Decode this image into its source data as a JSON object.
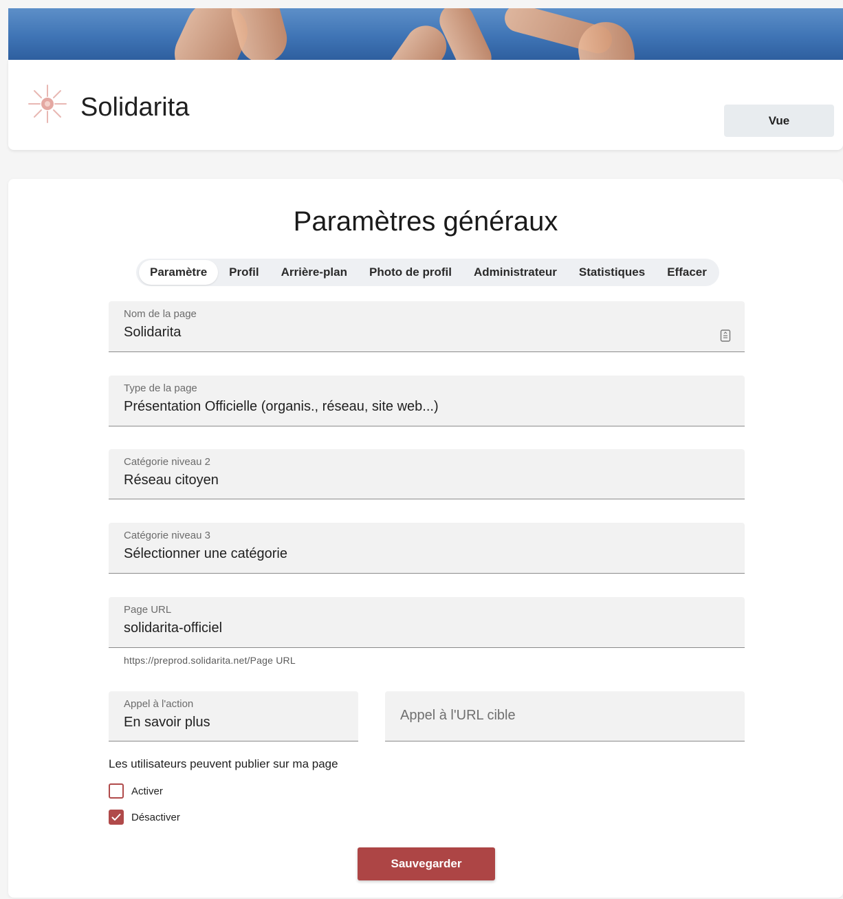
{
  "header": {
    "page_name": "Solidarita",
    "view_button": "Vue"
  },
  "main": {
    "title": "Paramètres généraux",
    "tabs": [
      {
        "label": "Paramètre",
        "active": true
      },
      {
        "label": "Profil",
        "active": false
      },
      {
        "label": "Arrière-plan",
        "active": false
      },
      {
        "label": "Photo de profil",
        "active": false
      },
      {
        "label": "Administrateur",
        "active": false
      },
      {
        "label": "Statistiques",
        "active": false
      },
      {
        "label": "Effacer",
        "active": false
      }
    ],
    "fields": {
      "page_name": {
        "label": "Nom de la page",
        "value": "Solidarita"
      },
      "page_type": {
        "label": "Type de la page",
        "value": "Présentation Officielle (organis., réseau, site web...)"
      },
      "category_2": {
        "label": "Catégorie niveau 2",
        "value": "Réseau citoyen"
      },
      "category_3": {
        "label": "Catégorie niveau 3",
        "value": "Sélectionner une catégorie"
      },
      "page_url": {
        "label": "Page URL",
        "value": "solidarita-officiel",
        "hint": "https://preprod.solidarita.net/Page URL"
      },
      "cta": {
        "label": "Appel à l'action",
        "value": "En savoir plus"
      },
      "cta_url": {
        "placeholder": "Appel à l'URL cible"
      }
    },
    "posting": {
      "question": "Les utilisateurs peuvent publier sur ma page",
      "options": [
        {
          "label": "Activer",
          "checked": false
        },
        {
          "label": "Désactiver",
          "checked": true
        }
      ]
    },
    "save_button": "Sauvegarder"
  },
  "colors": {
    "accent": "#ad4545",
    "banner": "#3f74b5"
  }
}
